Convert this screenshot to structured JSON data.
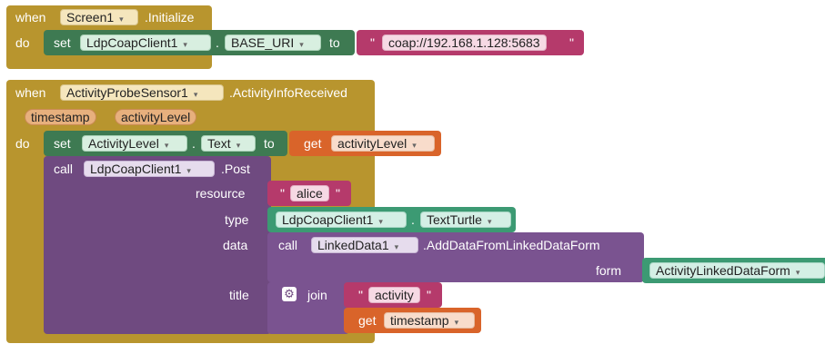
{
  "block1": {
    "event_kw": "when",
    "component": "Screen1",
    "event": ".Initialize",
    "do_kw": "do",
    "set_kw": "set",
    "target_component": "LdpCoapClient1",
    "dot": ".",
    "property": "BASE_URI",
    "to_kw": "to",
    "quote_open": "\"",
    "value": "coap://192.168.1.128:5683",
    "quote_close": "\""
  },
  "block2": {
    "event_kw": "when",
    "component": "ActivityProbeSensor1",
    "event": ".ActivityInfoReceived",
    "params": [
      "timestamp",
      "activityLevel"
    ],
    "do_kw": "do",
    "set_kw": "set",
    "set_component": "ActivityLevel",
    "set_dot": ".",
    "set_property": "Text",
    "to_kw": "to",
    "get_kw": "get",
    "get_var": "activityLevel",
    "call_kw": "call",
    "call_component": "LdpCoapClient1",
    "call_method": ".Post",
    "arg_resource": "resource",
    "arg_type": "type",
    "arg_data": "data",
    "arg_title": "title",
    "resource_quote_open": "\"",
    "resource_value": "alice",
    "resource_quote_close": "\"",
    "type_component": "LdpCoapClient1",
    "type_dot": ".",
    "type_property": "TextTurtle",
    "data_call_kw": "call",
    "data_component": "LinkedData1",
    "data_method": ".AddDataFromLinkedDataForm",
    "form_label": "form",
    "form_value": "ActivityLinkedDataForm",
    "join_kw": "join",
    "title_quote_open": "\"",
    "title_text": "activity",
    "title_quote_close": "\"",
    "title_get_kw": "get",
    "title_get_var": "timestamp"
  },
  "dropdown_arrow": "▾",
  "gear_icon": "gear-icon"
}
